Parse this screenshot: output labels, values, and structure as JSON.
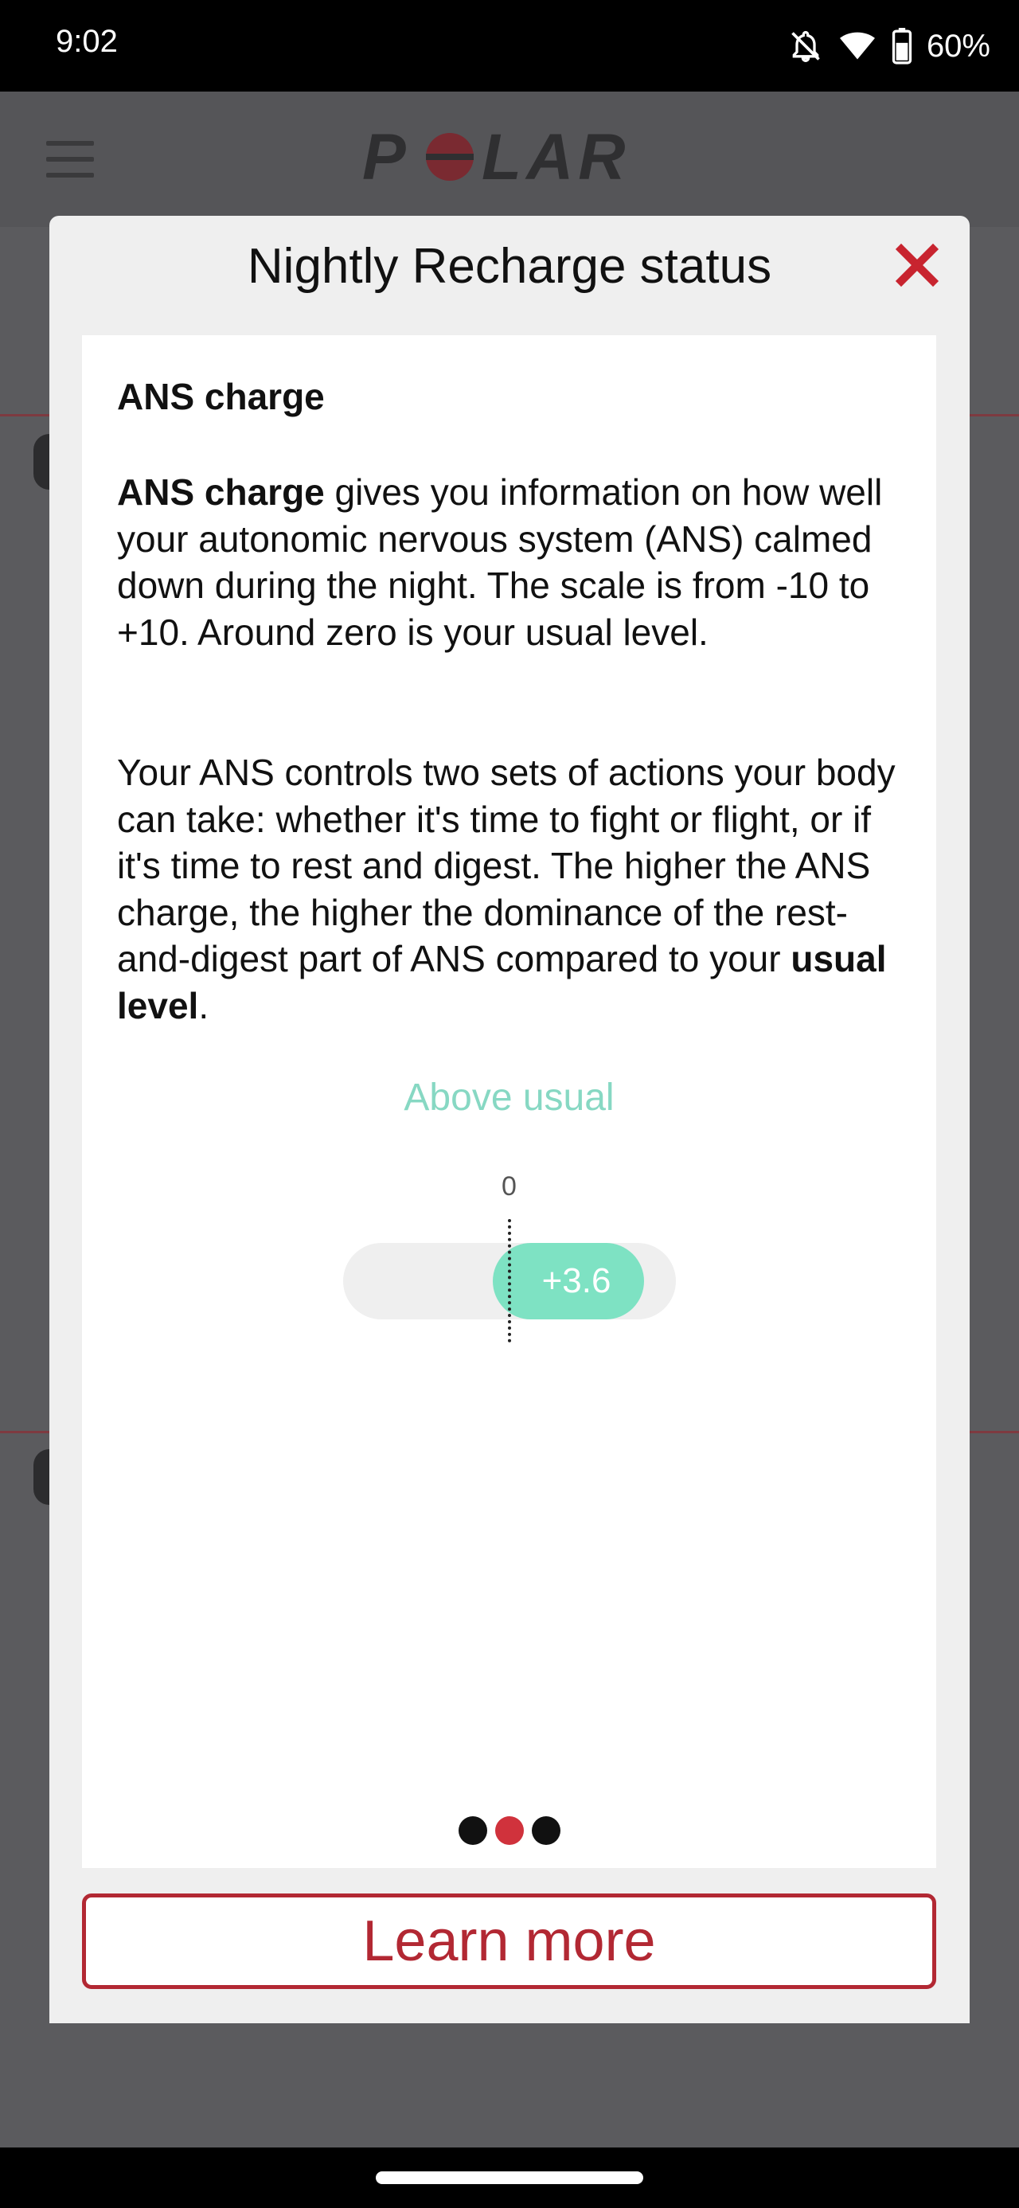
{
  "status_bar": {
    "time": "9:02",
    "battery": "60%",
    "icons": [
      "notifications-off-icon",
      "wifi-icon",
      "battery-icon"
    ]
  },
  "app": {
    "brand_logo_text": "POLAR",
    "colors": {
      "brand_red": "#d0323c",
      "header_bg": "#555558"
    }
  },
  "modal": {
    "title": "Nightly Recharge status",
    "close_icon": "close-icon",
    "heading": "ANS charge",
    "paragraph1": {
      "bold_lead": "ANS charge",
      "text": " gives you information on how well your autonomic nervous system (ANS) calmed down during the night. The scale is from -10 to +10. Around zero is your usual level."
    },
    "paragraph2": {
      "text": "Your ANS controls two sets of actions your body can take: whether it's time to fight or flight, or if it's time to rest and digest. The higher the ANS charge, the higher the dominance of the rest-and-digest part of ANS compared to your ",
      "bold_tail": "usual level",
      "end": "."
    },
    "gauge": {
      "status": "Above usual",
      "zero_label": "0",
      "value": "+3.6",
      "scale_min": -10,
      "scale_max": 10,
      "accent_color": "#7ee2c3"
    },
    "pagination": {
      "count": 3,
      "active_index": 1
    },
    "learn_more_label": "Learn more"
  }
}
